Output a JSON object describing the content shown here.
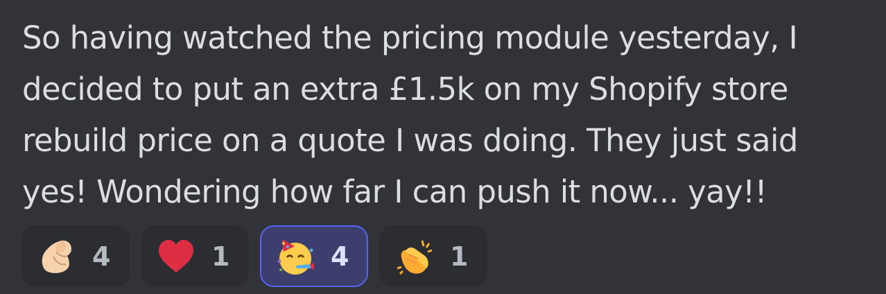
{
  "message": {
    "lines": [
      "So having watched the pricing module yesterday, I",
      "decided to put an extra £1.5k on my Shopify store",
      "rebuild price on a quote I was doing. They just said",
      "yes! Wondering how far I can push it now... yay!!"
    ]
  },
  "reactions": [
    {
      "emoji": "pinched-fingers-icon",
      "count": "4",
      "selected": false
    },
    {
      "emoji": "red-heart-icon",
      "count": "1",
      "selected": false
    },
    {
      "emoji": "partying-face-icon",
      "count": "4",
      "selected": true
    },
    {
      "emoji": "clapping-hands-icon",
      "count": "1",
      "selected": false
    }
  ],
  "colors": {
    "background": "#323339",
    "text": "#dbdee1",
    "reaction_bg": "#2b2d31",
    "reaction_active_bg": "#3c3e6d",
    "reaction_active_border": "#5865f2"
  }
}
